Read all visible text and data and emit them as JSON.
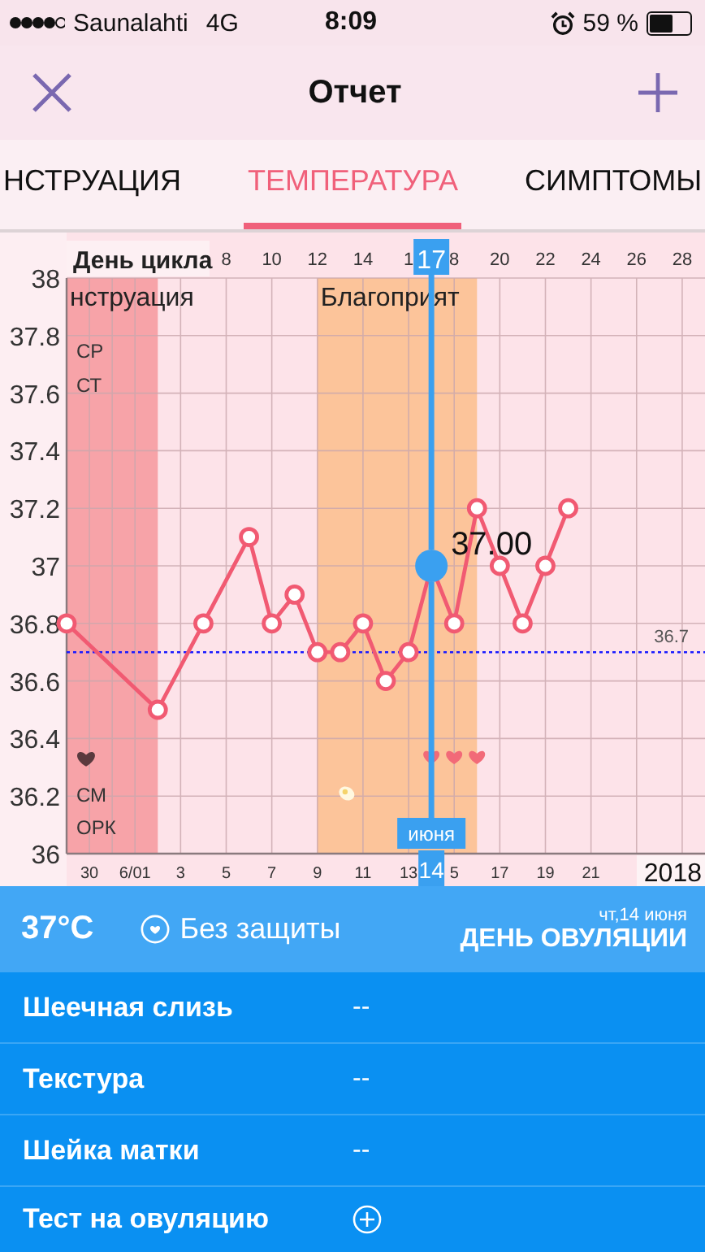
{
  "status_bar": {
    "carrier": "Saunalahti",
    "network": "4G",
    "time": "8:09",
    "battery": "59 %"
  },
  "nav": {
    "title": "Отчет"
  },
  "tabs": [
    {
      "label": "НСТРУАЦИЯ",
      "selected": false
    },
    {
      "label": "ТЕМПЕРАТУРА",
      "selected": true
    },
    {
      "label": "СИМПТОМЫ",
      "selected": false
    }
  ],
  "cycle_axis": {
    "title": "День цикла",
    "ticks": [
      "8",
      "10",
      "12",
      "14",
      "1",
      "8",
      "20",
      "22",
      "24",
      "26",
      "28"
    ]
  },
  "phases": [
    {
      "label": "нструация",
      "color": "#f7a3a8"
    },
    {
      "label": "Благоприят",
      "color": "#fcc49a"
    }
  ],
  "chart_rows": {
    "top": [
      "СР",
      "СТ"
    ],
    "bottom": [
      "СМ",
      "ОРК"
    ]
  },
  "chart_data": {
    "type": "line",
    "grid": true,
    "categories": [
      null,
      "30",
      null,
      "6/01",
      null,
      "3",
      null,
      "5",
      null,
      "7",
      null,
      "9",
      null,
      "11",
      null,
      "13",
      null,
      "5",
      null,
      "17",
      null,
      "19",
      null,
      "21",
      null,
      null,
      null,
      null,
      null
    ],
    "series": [
      {
        "color": "#f15a72",
        "marker": "o",
        "values": [
          36.8,
          null,
          null,
          null,
          36.5,
          null,
          36.8,
          null,
          37.1,
          36.8,
          36.9,
          36.7,
          36.7,
          36.8,
          36.6,
          36.7,
          37.0,
          36.8,
          37.2,
          37.0,
          36.8,
          37.0,
          37.2,
          null,
          null,
          null,
          null,
          null,
          null
        ]
      }
    ],
    "ylim": [
      36,
      38
    ],
    "yticks": [
      36,
      36.2,
      36.4,
      36.6,
      36.8,
      37,
      37.2,
      37.4,
      37.6,
      37.8,
      38
    ],
    "ref_lines": [
      {
        "axis": "y",
        "value": 36.7,
        "label": "36.7",
        "color": "#1a1aff"
      }
    ],
    "annotations": [
      "17",
      "37.00",
      "июня",
      "14"
    ]
  },
  "year": "2018",
  "summary": {
    "temperature": "37°C",
    "protection": "Без защиты",
    "date": "чт,14 июня",
    "day_type": "ДЕНЬ ОВУЛЯЦИИ"
  },
  "rows": [
    {
      "kind": "value",
      "label": "Шеечная слизь",
      "value": "--"
    },
    {
      "kind": "value",
      "label": "Текстура",
      "value": "--"
    },
    {
      "kind": "value",
      "label": "Шейка матки",
      "value": "--"
    },
    {
      "kind": "add",
      "label": "Тест на овуляцию"
    }
  ]
}
